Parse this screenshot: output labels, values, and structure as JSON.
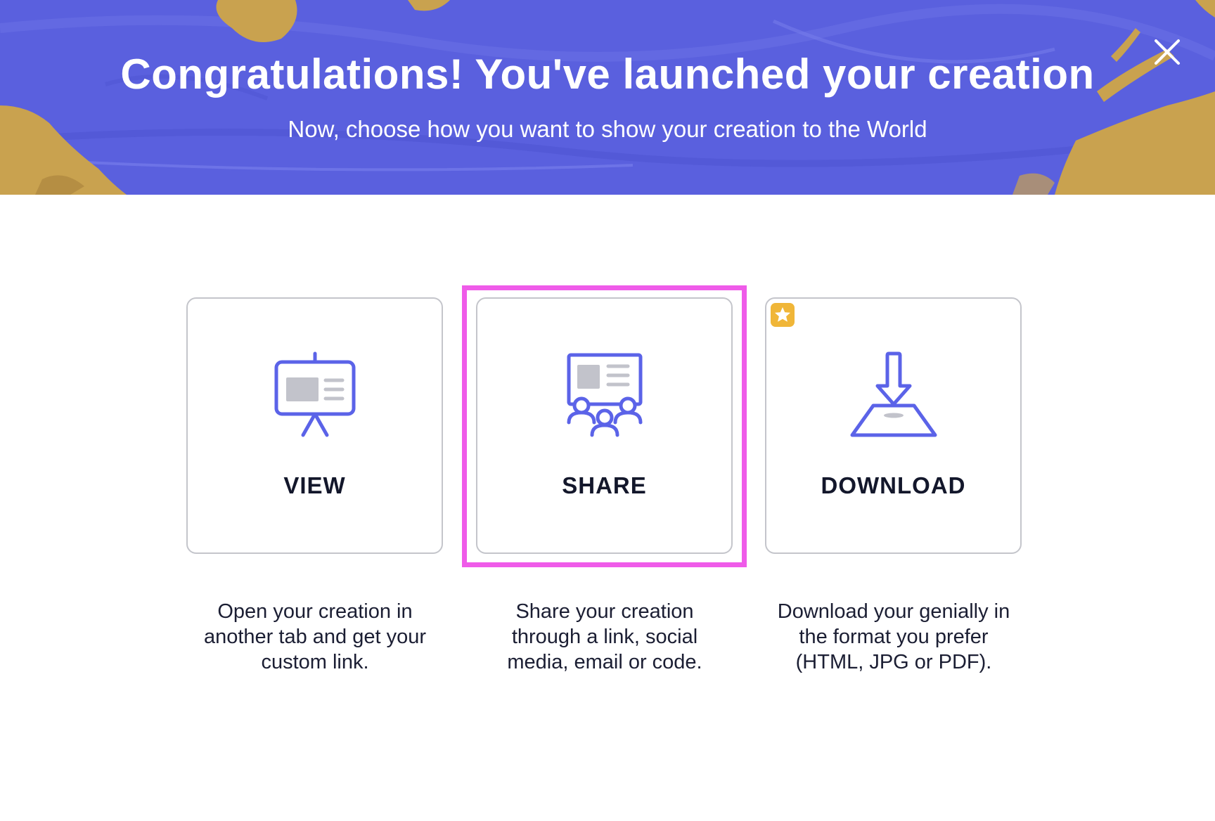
{
  "header": {
    "title": "Congratulations! You've launched your creation",
    "subtitle": "Now, choose how you want to show your creation to the World",
    "close_icon": "close-icon"
  },
  "options": [
    {
      "label": "VIEW",
      "icon": "presentation-board-icon",
      "description_lines": [
        "Open your creation in",
        "another tab and get your",
        "custom link."
      ]
    },
    {
      "label": "SHARE",
      "icon": "share-audience-icon",
      "highlighted": true,
      "description_lines": [
        "Share your creation",
        "through a link, social",
        "media, email or code."
      ]
    },
    {
      "label": "DOWNLOAD",
      "icon": "download-icon",
      "badge_icon": "star-premium-icon",
      "description_lines": [
        "Download your genially in",
        "the format you prefer",
        "(HTML, JPG or PDF)."
      ]
    }
  ],
  "colors": {
    "header_bg": "#5a60de",
    "gold": "#c9a24f",
    "icon_stroke": "#5b63e8",
    "icon_fill_gray": "#c2c3cb",
    "highlight": "#ef5be9",
    "badge": "#f0b638",
    "text_dark": "#13172b"
  }
}
